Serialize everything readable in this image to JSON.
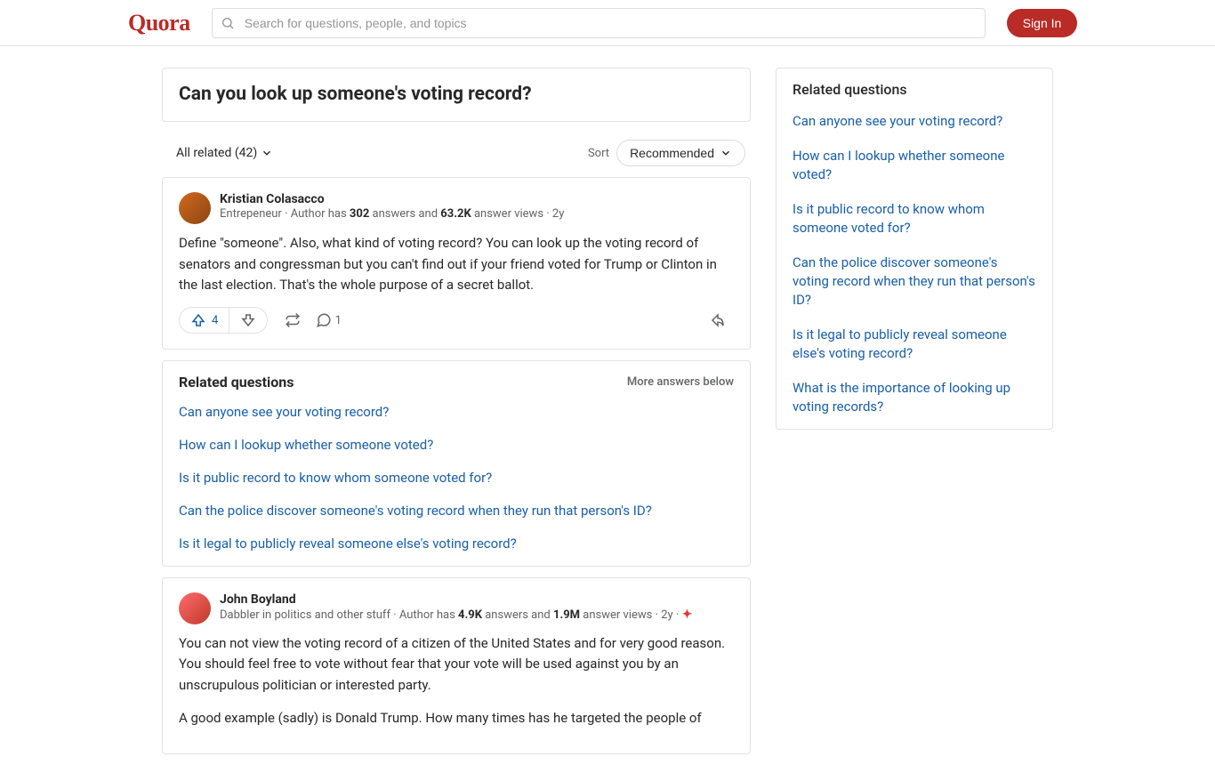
{
  "header": {
    "logo": "Quora",
    "search_placeholder": "Search for questions, people, and topics",
    "signin": "Sign In"
  },
  "question": {
    "title": "Can you look up someone's voting record?"
  },
  "filter": {
    "label": "All related (42)",
    "sort_label": "Sort",
    "sort_value": "Recommended"
  },
  "answers": [
    {
      "author_name": "Kristian Colasacco",
      "author_desc": "Entrepeneur",
      "author_stats_prefix": "Author has ",
      "answer_count": "302",
      "answers_word": " answers and ",
      "view_count": "63.2K",
      "views_word": " answer views",
      "time": "2y",
      "body": "Define \"someone\". Also, what kind of voting record? You can look up the voting record of senators and congressman but you can't find out if your friend voted for Trump or Clinton in the last election. That's the whole purpose of a secret ballot.",
      "upvotes": "4",
      "comments": "1"
    },
    {
      "author_name": "John Boyland",
      "author_desc": "Dabbler in politics and other stuff",
      "author_stats_prefix": "Author has ",
      "answer_count": "4.9K",
      "answers_word": " answers and ",
      "view_count": "1.9M",
      "views_word": " answer views",
      "time": "2y",
      "body_p1": "You can not view the voting record of a citizen of the United States and for very good reason. You should feel free to vote without fear that your vote will be used against you by an unscrupulous politician or interested party.",
      "body_p2": "A good example (sadly) is Donald Trump. How many times has he targeted the people of"
    }
  ],
  "related_inline": {
    "title": "Related questions",
    "more": "More answers below",
    "items": [
      "Can anyone see your voting record?",
      "How can I lookup whether someone voted?",
      "Is it public record to know whom someone voted for?",
      "Can the police discover someone's voting record when they run that person's ID?",
      "Is it legal to publicly reveal someone else's voting record?"
    ]
  },
  "sidebar": {
    "title": "Related questions",
    "items": [
      "Can anyone see your voting record?",
      "How can I lookup whether someone voted?",
      "Is it public record to know whom someone voted for?",
      "Can the police discover someone's voting record when they run that person's ID?",
      "Is it legal to publicly reveal someone else's voting record?",
      "What is the importance of looking up voting records?"
    ]
  }
}
